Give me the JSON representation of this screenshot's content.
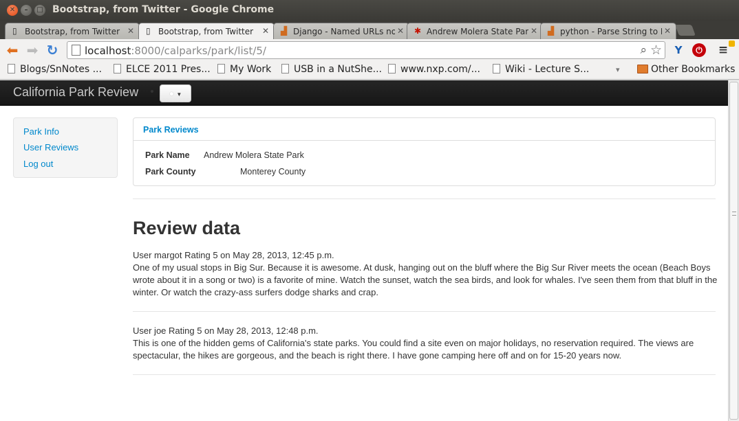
{
  "window": {
    "title": "Bootstrap, from Twitter - Google Chrome"
  },
  "tabs": [
    {
      "label": "Bootstrap, from Twitter",
      "icon": "page-icon"
    },
    {
      "label": "Bootstrap, from Twitter",
      "icon": "page-icon"
    },
    {
      "label": "Django - Named URLs not",
      "icon": "stackoverflow-icon"
    },
    {
      "label": "Andrew Molera State Park",
      "icon": "yelp-icon"
    },
    {
      "label": "python - Parse String to F",
      "icon": "stackoverflow-icon"
    }
  ],
  "omnibox": {
    "host": "localhost",
    "rest": ":8000/calparks/park/list/5/"
  },
  "bookmarks": [
    {
      "label": "Blogs/SnNotes ..."
    },
    {
      "label": "ELCE 2011 Pres..."
    },
    {
      "label": "My Work"
    },
    {
      "label": "USB in a NutShe..."
    },
    {
      "label": "www.nxp.com/..."
    },
    {
      "label": "Wiki - Lecture S..."
    }
  ],
  "bookmarks_overflow": "▾",
  "other_bookmarks": "Other Bookmarks",
  "site": {
    "brand": "California Park Review",
    "user_button_icon": "user-icon"
  },
  "sidebar": {
    "items": [
      {
        "label": "Park Info"
      },
      {
        "label": "User Reviews"
      },
      {
        "label": "Log out"
      }
    ]
  },
  "panel": {
    "heading": "Park Reviews",
    "park_name_label": "Park Name",
    "park_name_value": "Andrew Molera State Park",
    "park_county_label": "Park County",
    "park_county_value": "Monterey County"
  },
  "reviews_heading": "Review data",
  "reviews": [
    {
      "meta": "User margot Rating 5 on May 28, 2013, 12:45 p.m.",
      "text": "One of my usual stops in Big Sur. Because it is awesome. At dusk, hanging out on the bluff where the Big Sur River meets the ocean (Beach Boys wrote about it in a song or two) is a favorite of mine. Watch the sunset, watch the sea birds, and look for whales. I've seen them from that bluff in the winter. Or watch the crazy-ass surfers dodge sharks and crap."
    },
    {
      "meta": "User joe Rating 5 on May 28, 2013, 12:48 p.m.",
      "text": "This is one of the hidden gems of California's state parks. You could find a site even on major holidays, no reservation required. The views are spectacular, the hikes are gorgeous, and the beach is right there. I have gone camping here off and on for 15-20 years now."
    }
  ]
}
